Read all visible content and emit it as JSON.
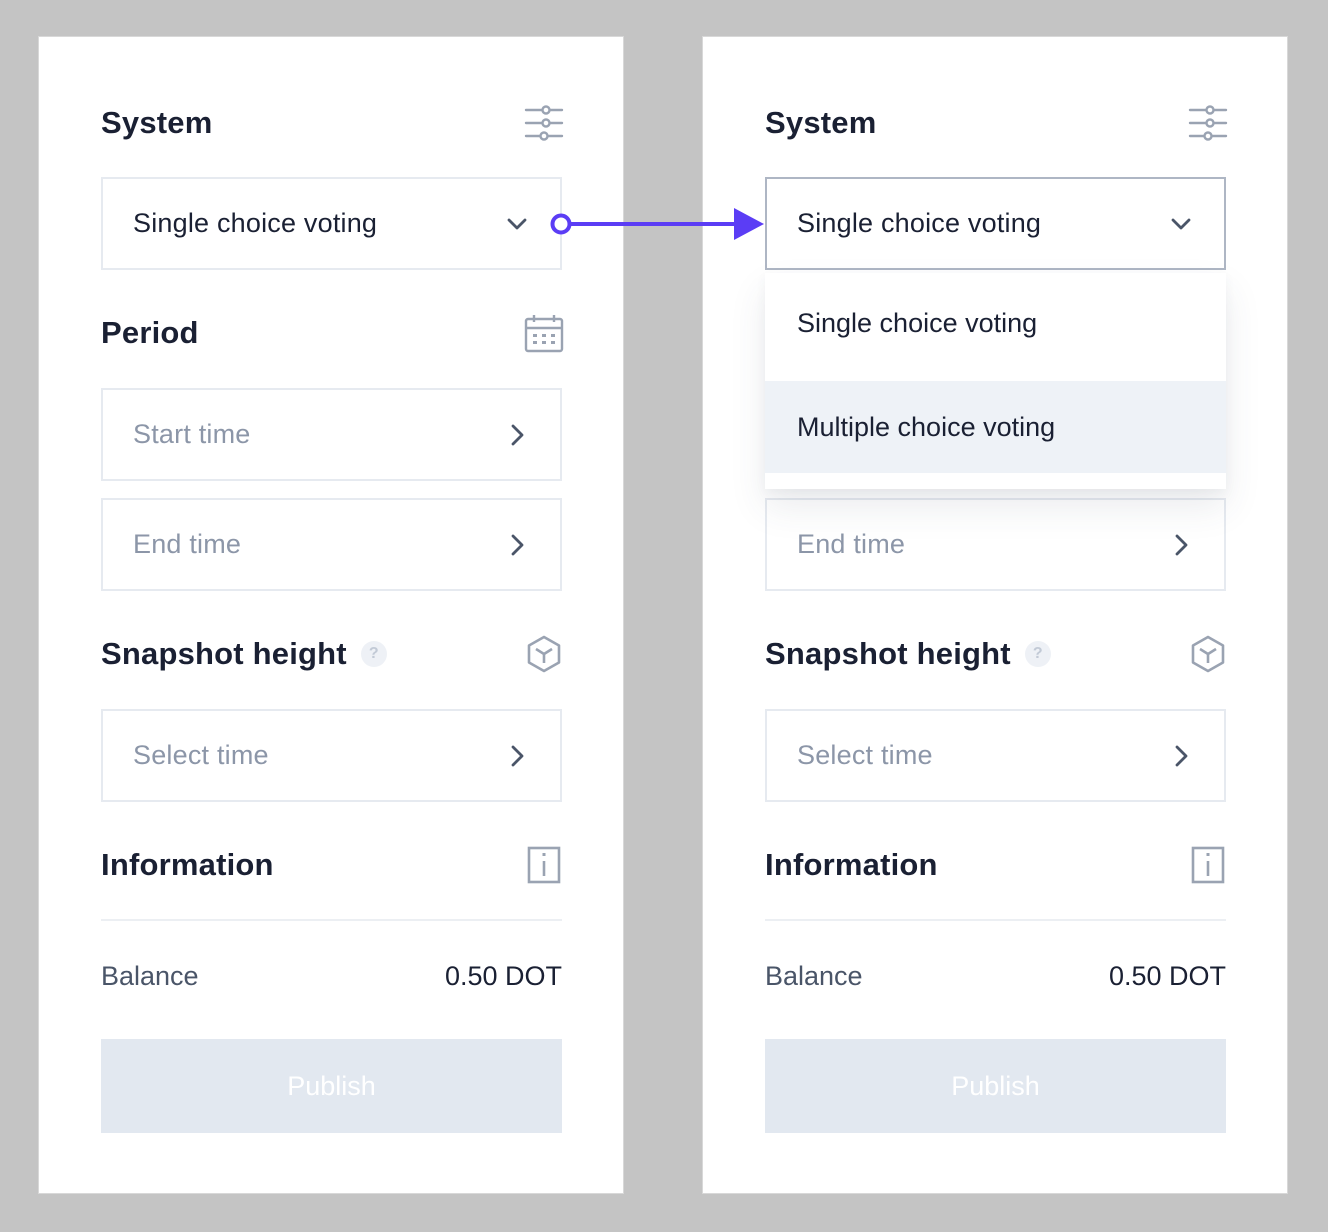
{
  "left": {
    "system": {
      "title": "System",
      "icon": "sliders-icon",
      "selected": "Single choice voting"
    },
    "period": {
      "title": "Period",
      "icon": "calendar-icon",
      "start_placeholder": "Start time",
      "end_placeholder": "End time"
    },
    "snapshot": {
      "title": "Snapshot height",
      "help": "?",
      "icon": "cube-icon",
      "placeholder": "Select time"
    },
    "information": {
      "title": "Information",
      "icon": "info-icon",
      "balance_label": "Balance",
      "balance_value": "0.50 DOT"
    },
    "publish_label": "Publish"
  },
  "right": {
    "system": {
      "title": "System",
      "icon": "sliders-icon",
      "selected": "Single choice voting"
    },
    "dropdown": {
      "options": [
        "Single choice voting",
        "Multiple choice voting"
      ],
      "hovered": "Multiple choice voting"
    },
    "period": {
      "end_placeholder": "End time"
    },
    "snapshot": {
      "title": "Snapshot height",
      "help": "?",
      "icon": "cube-icon",
      "placeholder": "Select time"
    },
    "information": {
      "title": "Information",
      "icon": "info-icon",
      "balance_label": "Balance",
      "balance_value": "0.50 DOT"
    },
    "publish_label": "Publish"
  },
  "colors": {
    "accent": "#5b3df5",
    "disabled_button": "#e2e8f0",
    "background": "#c4c4c4"
  }
}
